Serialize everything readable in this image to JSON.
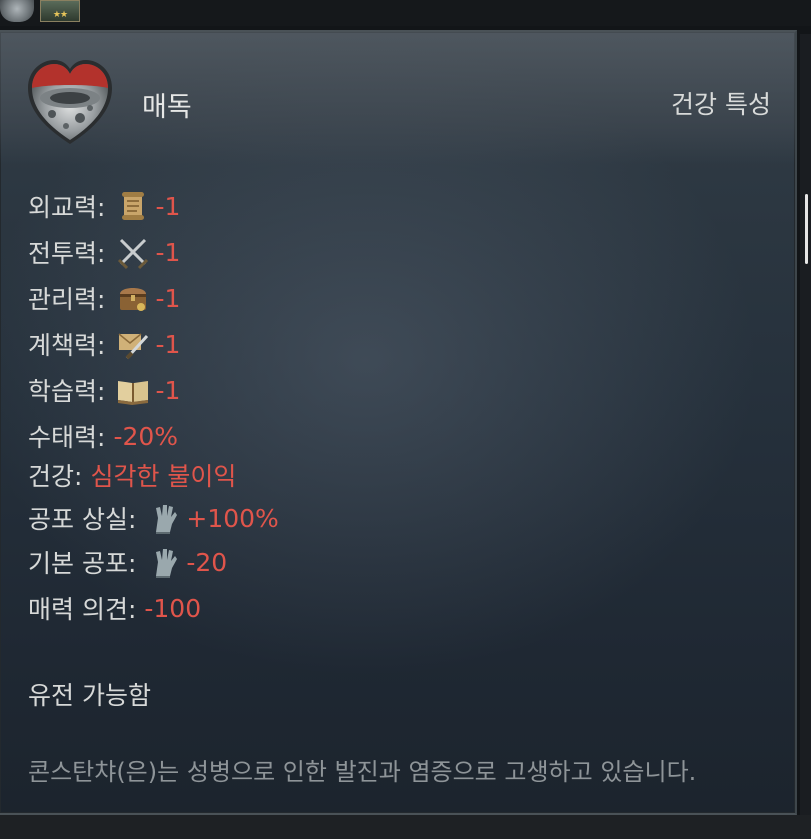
{
  "top_bar": {
    "rank_stars": "★★"
  },
  "trait": {
    "name": "매독",
    "category": "건강 특성",
    "icon": "syphilis-heart-icon"
  },
  "stats": [
    {
      "label": "외교력:",
      "icon": "scroll-icon",
      "value": "-1"
    },
    {
      "label": "전투력:",
      "icon": "crossed-swords-icon",
      "value": "-1"
    },
    {
      "label": "관리력:",
      "icon": "treasure-chest-icon",
      "value": "-1"
    },
    {
      "label": "계책력:",
      "icon": "letter-dagger-icon",
      "value": "-1"
    },
    {
      "label": "학습력:",
      "icon": "open-book-icon",
      "value": "-1"
    },
    {
      "label": "수태력:",
      "icon": "",
      "value": "-20%"
    },
    {
      "label": "건강:",
      "icon": "",
      "value": "심각한 불이익"
    },
    {
      "label": "공포 상실:",
      "icon": "gauntlet-icon",
      "value": "+100%"
    },
    {
      "label": "기본 공포:",
      "icon": "gauntlet-icon",
      "value": "-20"
    },
    {
      "label": "매력 의견:",
      "icon": "",
      "value": "-100"
    }
  ],
  "inheritable": "유전 가능함",
  "description": "콘스탄챠(은)는 성병으로 인한 발진과 염증으로 고생하고 있습니다.",
  "colors": {
    "negative_value": "#e0554b",
    "label_text": "#d7d9d8",
    "description_text": "#8e9498",
    "panel_border": "#4a5257"
  }
}
